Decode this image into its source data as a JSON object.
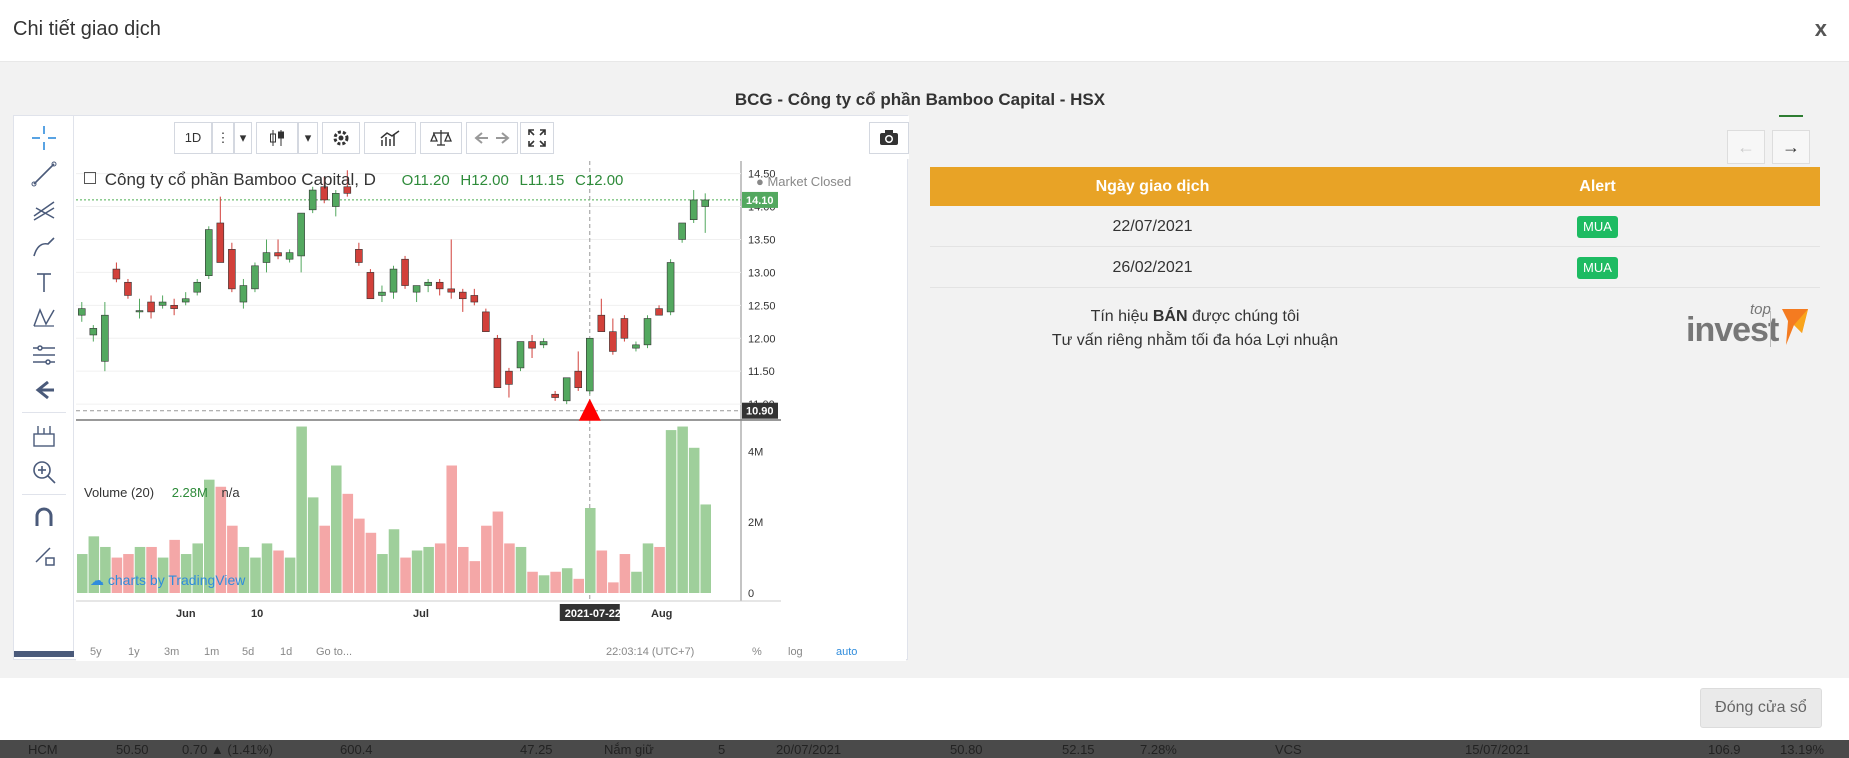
{
  "modal": {
    "title": "Chi tiết giao dịch",
    "close_label": "x",
    "chart_heading": "BCG - Công ty cổ phần Bamboo Capital - HSX",
    "footer_button": "Đóng cửa sổ"
  },
  "toolbar": {
    "interval": "1D",
    "more": "⋮",
    "dropdown": "▾"
  },
  "chart": {
    "symbol_title": "Công ty cổ phần Bamboo Capital, D",
    "open_label": "O11.20",
    "high_label": "H12.00",
    "low_label": "L11.15",
    "close_label": "C12.00",
    "market_status": "● Market Closed",
    "last_price": "14.10",
    "crosshair_price": "10.90",
    "crosshair_date": "2021-07-22",
    "watermark": "charts by TradingView",
    "price_ticks": [
      "14.50",
      "14.00",
      "13.50",
      "13.00",
      "12.50",
      "12.00",
      "11.50",
      "11.00"
    ],
    "volume_ticks": [
      "4M",
      "2M",
      "0"
    ],
    "time_labels": [
      "Jun",
      "10",
      "Jul",
      "Aug"
    ],
    "volume_title": "Volume (20)",
    "volume_value": "2.28M",
    "volume_na": "n/a",
    "range_buttons": [
      "5y",
      "1y",
      "3m",
      "1m",
      "5d",
      "1d",
      "Go to..."
    ],
    "clock": "22:03:14 (UTC+7)",
    "pct": "%",
    "log": "log",
    "auto": "auto",
    "colors": {
      "up": "#53a85f",
      "down": "#d2403a",
      "up_vol": "#9fcf9b",
      "down_vol": "#f4a7a7",
      "marker": "#ff0000"
    }
  },
  "chart_data": {
    "type": "candlestick",
    "symbol": "BCG",
    "interval": "1D",
    "y_range": [
      10.85,
      14.6
    ],
    "volume_range": [
      0,
      4800000
    ],
    "candles": [
      {
        "o": 12.35,
        "h": 12.55,
        "l": 12.25,
        "c": 12.45
      },
      {
        "o": 12.05,
        "h": 12.2,
        "l": 11.95,
        "c": 12.15
      },
      {
        "o": 11.65,
        "h": 12.55,
        "l": 11.5,
        "c": 12.35
      },
      {
        "o": 13.05,
        "h": 13.15,
        "l": 12.85,
        "c": 12.9
      },
      {
        "o": 12.85,
        "h": 12.9,
        "l": 12.6,
        "c": 12.65
      },
      {
        "o": 12.4,
        "h": 12.6,
        "l": 12.3,
        "c": 12.42
      },
      {
        "o": 12.55,
        "h": 12.65,
        "l": 12.3,
        "c": 12.4
      },
      {
        "o": 12.5,
        "h": 12.65,
        "l": 12.45,
        "c": 12.55
      },
      {
        "o": 12.5,
        "h": 12.6,
        "l": 12.35,
        "c": 12.45
      },
      {
        "o": 12.55,
        "h": 12.7,
        "l": 12.5,
        "c": 12.6
      },
      {
        "o": 12.7,
        "h": 12.9,
        "l": 12.65,
        "c": 12.85
      },
      {
        "o": 12.95,
        "h": 13.7,
        "l": 12.9,
        "c": 13.65
      },
      {
        "o": 13.75,
        "h": 14.15,
        "l": 13.6,
        "c": 13.15
      },
      {
        "o": 13.35,
        "h": 13.45,
        "l": 12.7,
        "c": 12.75
      },
      {
        "o": 12.55,
        "h": 12.9,
        "l": 12.45,
        "c": 12.8
      },
      {
        "o": 12.75,
        "h": 13.15,
        "l": 12.7,
        "c": 13.1
      },
      {
        "o": 13.15,
        "h": 13.5,
        "l": 13.0,
        "c": 13.3
      },
      {
        "o": 13.3,
        "h": 13.5,
        "l": 13.2,
        "c": 13.25
      },
      {
        "o": 13.2,
        "h": 13.35,
        "l": 13.15,
        "c": 13.3
      },
      {
        "o": 13.25,
        "h": 13.9,
        "l": 13.0,
        "c": 13.9
      },
      {
        "o": 13.95,
        "h": 14.3,
        "l": 13.9,
        "c": 14.25
      },
      {
        "o": 14.3,
        "h": 14.45,
        "l": 14.05,
        "c": 14.1
      },
      {
        "o": 14.0,
        "h": 14.25,
        "l": 13.85,
        "c": 14.2
      },
      {
        "o": 14.3,
        "h": 14.55,
        "l": 14.15,
        "c": 14.2
      },
      {
        "o": 13.35,
        "h": 13.45,
        "l": 13.1,
        "c": 13.15
      },
      {
        "o": 13.0,
        "h": 13.05,
        "l": 12.6,
        "c": 12.6
      },
      {
        "o": 12.65,
        "h": 12.8,
        "l": 12.55,
        "c": 12.7
      },
      {
        "o": 12.7,
        "h": 13.1,
        "l": 12.6,
        "c": 13.05
      },
      {
        "o": 13.2,
        "h": 13.25,
        "l": 12.75,
        "c": 12.8
      },
      {
        "o": 12.7,
        "h": 12.8,
        "l": 12.55,
        "c": 12.8
      },
      {
        "o": 12.8,
        "h": 12.9,
        "l": 12.7,
        "c": 12.85
      },
      {
        "o": 12.85,
        "h": 12.9,
        "l": 12.65,
        "c": 12.75
      },
      {
        "o": 12.75,
        "h": 13.5,
        "l": 12.6,
        "c": 12.7
      },
      {
        "o": 12.7,
        "h": 12.75,
        "l": 12.4,
        "c": 12.6
      },
      {
        "o": 12.65,
        "h": 12.75,
        "l": 12.5,
        "c": 12.55
      },
      {
        "o": 12.4,
        "h": 12.45,
        "l": 12.1,
        "c": 12.1
      },
      {
        "o": 12.0,
        "h": 12.05,
        "l": 11.25,
        "c": 11.25
      },
      {
        "o": 11.5,
        "h": 11.55,
        "l": 11.1,
        "c": 11.3
      },
      {
        "o": 11.55,
        "h": 11.95,
        "l": 11.5,
        "c": 11.95
      },
      {
        "o": 11.95,
        "h": 12.05,
        "l": 11.7,
        "c": 11.85
      },
      {
        "o": 11.9,
        "h": 12.0,
        "l": 11.85,
        "c": 11.95
      },
      {
        "o": 11.15,
        "h": 11.2,
        "l": 11.05,
        "c": 11.1
      },
      {
        "o": 11.05,
        "h": 11.4,
        "l": 11.0,
        "c": 11.4
      },
      {
        "o": 11.5,
        "h": 11.8,
        "l": 11.2,
        "c": 11.25
      },
      {
        "o": 11.2,
        "h": 12.0,
        "l": 11.15,
        "c": 12.0
      },
      {
        "o": 12.35,
        "h": 12.6,
        "l": 12.3,
        "c": 12.1
      },
      {
        "o": 12.1,
        "h": 12.3,
        "l": 11.75,
        "c": 11.8
      },
      {
        "o": 12.3,
        "h": 12.35,
        "l": 11.95,
        "c": 12.0
      },
      {
        "o": 11.85,
        "h": 11.95,
        "l": 11.8,
        "c": 11.9
      },
      {
        "o": 11.9,
        "h": 12.35,
        "l": 11.85,
        "c": 12.3
      },
      {
        "o": 12.45,
        "h": 12.5,
        "l": 12.35,
        "c": 12.35
      },
      {
        "o": 12.4,
        "h": 13.2,
        "l": 12.35,
        "c": 13.15
      },
      {
        "o": 13.5,
        "h": 13.75,
        "l": 13.45,
        "c": 13.75
      },
      {
        "o": 13.8,
        "h": 14.25,
        "l": 13.75,
        "c": 14.1
      },
      {
        "o": 14.0,
        "h": 14.2,
        "l": 13.6,
        "c": 14.1
      }
    ],
    "volume": [
      1.1,
      1.6,
      1.3,
      1.0,
      1.1,
      1.3,
      1.3,
      1.0,
      1.5,
      1.1,
      1.4,
      3.2,
      3.0,
      1.9,
      1.3,
      1.0,
      1.4,
      1.2,
      1.0,
      4.7,
      2.7,
      1.9,
      3.6,
      2.8,
      2.1,
      1.7,
      1.1,
      1.8,
      1.0,
      1.2,
      1.3,
      1.4,
      3.6,
      1.3,
      0.9,
      1.9,
      2.3,
      1.4,
      1.3,
      0.6,
      0.5,
      0.6,
      0.7,
      0.4,
      2.4,
      1.2,
      0.3,
      1.1,
      0.6,
      1.4,
      1.3,
      4.6,
      4.7,
      4.1,
      2.5
    ],
    "signals": [
      {
        "date": "2021-07-22",
        "type": "MUA",
        "price": 10.9
      }
    ]
  },
  "panel": {
    "prev_label": "←",
    "next_label": "→",
    "table_headers": [
      "Ngày giao dịch",
      "Alert"
    ],
    "rows": [
      {
        "date": "22/07/2021",
        "alert": "MUA"
      },
      {
        "date": "26/02/2021",
        "alert": "MUA"
      }
    ],
    "signal_prefix": "Tín hiệu ",
    "signal_bold": "BÁN",
    "signal_suffix": " được chúng tôi",
    "signal_line2": "Tư vấn riêng nhằm tối đa hóa Lợi nhuận",
    "brand_top": "top",
    "brand_name": "invest"
  },
  "background_table": {
    "cells": [
      "HCM",
      "50.50",
      "0.70 ▲ (1.41%)",
      "600.4",
      "47.25",
      "Nắm giữ",
      "5",
      "20/07/2021",
      "50.80",
      "52.15",
      "7.28%",
      "VCS",
      "15/07/2021",
      "106.9",
      "13.19%"
    ]
  }
}
